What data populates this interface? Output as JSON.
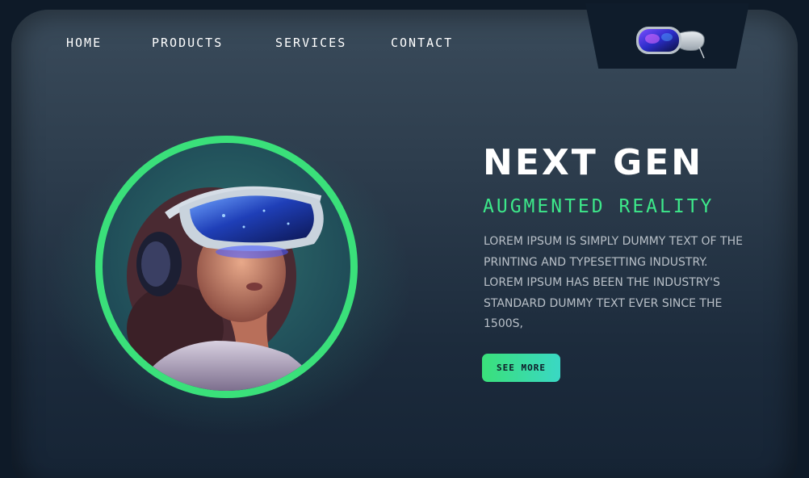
{
  "nav": {
    "items": [
      {
        "label": "HOME"
      },
      {
        "label": "PRODUCTS"
      },
      {
        "label": "SERVICES"
      },
      {
        "label": "CONTACT"
      }
    ]
  },
  "logo": {
    "icon": "vr-headset-icon"
  },
  "hero": {
    "title": "NEXT GEN",
    "subtitle": "AUGMENTED REALITY",
    "description": "LOREM IPSUM IS SIMPLY DUMMY TEXT OF THE PRINTING AND TYPESETTING INDUSTRY. LOREM IPSUM HAS BEEN THE INDUSTRY'S STANDARD DUMMY TEXT EVER SINCE THE 1500S,",
    "cta_label": "SEE MORE",
    "image": "woman-wearing-vr-headset"
  },
  "colors": {
    "accent": "#3ae07a",
    "accent_end": "#3ad8c4",
    "background": "#0e1a28",
    "panel": "#2e3e4e",
    "text": "#ffffff",
    "muted_text": "#b9c0c8"
  }
}
